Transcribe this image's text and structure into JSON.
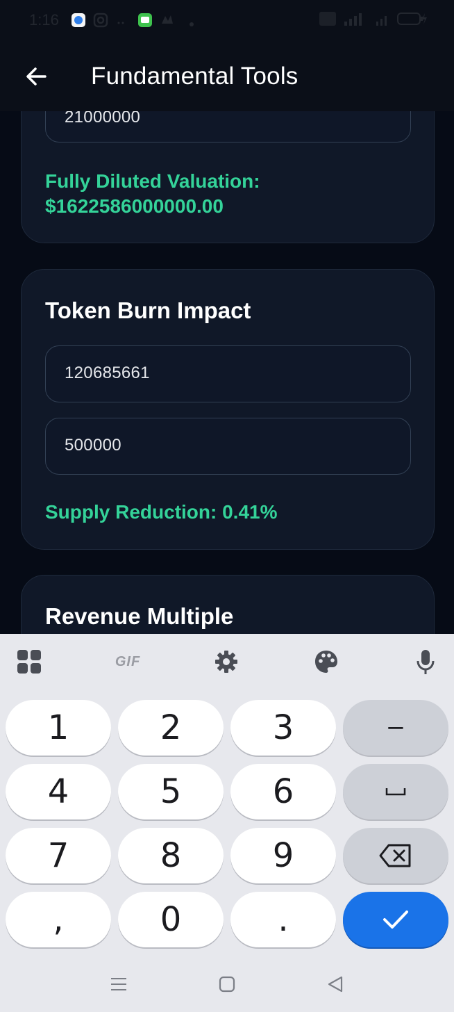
{
  "status_bar": {
    "time": "1:16"
  },
  "app_bar": {
    "title": "Fundamental Tools"
  },
  "fdv_card": {
    "supply_value": "21000000",
    "result_label": "Fully Diluted Valuation:",
    "result_value": "$1622586000000.00"
  },
  "burn_card": {
    "title": "Token Burn Impact",
    "total_supply_value": "120685661",
    "burn_amount_value": "500000",
    "result": "Supply Reduction: 0.41%"
  },
  "revenue_card": {
    "title": "Revenue Multiple"
  },
  "keyboard": {
    "toolbar": {
      "gif_label": "GIF"
    },
    "keys": {
      "k1": "1",
      "k2": "2",
      "k3": "3",
      "minus": "−",
      "k4": "4",
      "k5": "5",
      "k6": "6",
      "k7": "7",
      "k8": "8",
      "k9": "9",
      "comma": ",",
      "k0": "0",
      "period": "."
    }
  },
  "colors": {
    "accent_green": "#34d399",
    "keyboard_enter": "#1a73e8",
    "card_bg": "#101828"
  }
}
